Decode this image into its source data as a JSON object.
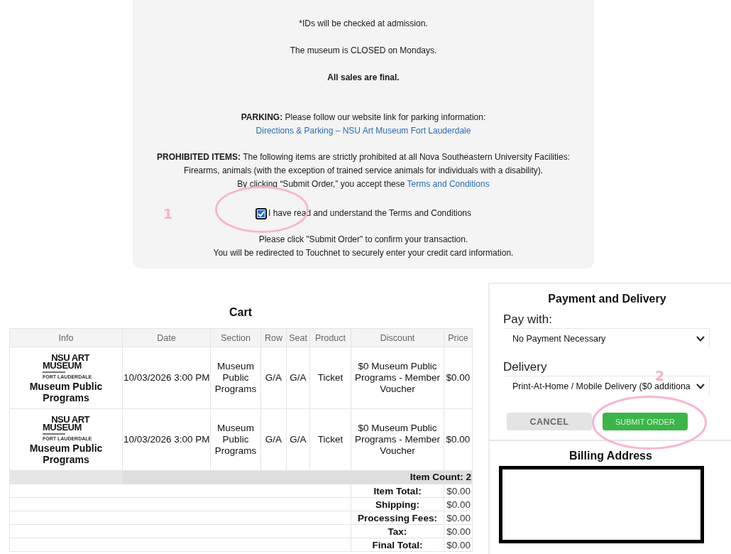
{
  "notice": {
    "id_note": "*IDs will be checked at admission.",
    "closed_note": "The museum is CLOSED on Mondays.",
    "final_note": "All sales are final.",
    "parking": {
      "text": "**PARKING:** Please follow our website link for parking information: ",
      "link": "Directions & Parking – NSU Art Museum Fort Lauderdale"
    },
    "prohibited": "**PROHIBITED ITEMS:** The following items are strictly prohibited at all Nova Southeastern University Facilities: Firearms, animals (with the exception of trained service animals for individuals with a disability).",
    "accept": {
      "text": "By clicking “Submit Order,” you accept these ",
      "link": "Terms and Conditions"
    },
    "agree": {
      "label": "I have read and understand the Terms and Conditions",
      "checked": true,
      "annotation": "1"
    },
    "instructions": [
      "Please click \"Submit Order\" to confirm your transaction.",
      "You will be redirected to Touchnet to securely enter your credit card information."
    ]
  },
  "cart": {
    "title": "Cart",
    "columns": [
      "Info",
      "Date",
      "Section",
      "Row",
      "Seat",
      "Product",
      "Discount",
      "Price"
    ],
    "rows": [
      {
        "logo": {
          "lines": [
            "NSU ART",
            "MUSEUM"
          ],
          "subtitle": "FORT LAUDERDALE"
        },
        "event": "Museum Public Programs",
        "date": "10/03/2026 3:00 PM",
        "section": "Museum Public Programs",
        "row": "G/A",
        "seat": "G/A",
        "product": "Ticket",
        "discount": "$0 Museum Public Programs - Member Voucher",
        "price": "$0.00"
      },
      {
        "logo": {
          "lines": [
            "NSU ART",
            "MUSEUM"
          ],
          "subtitle": "FORT LAUDERDALE"
        },
        "event": "Museum Public Programs",
        "date": "10/03/2026 3:00 PM",
        "section": "Museum Public Programs",
        "row": "G/A",
        "seat": "G/A",
        "product": "Ticket",
        "discount": "$0 Museum Public Programs - Member Voucher",
        "price": "$0.00"
      }
    ],
    "item_count": "Item Count: 2",
    "totals": [
      {
        "label": "Item Total:",
        "value": "$0.00"
      },
      {
        "label": "Shipping:",
        "value": "$0.00"
      },
      {
        "label": "Processing Fees:",
        "value": "$0.00"
      },
      {
        "label": "Tax:",
        "value": "$0.00"
      },
      {
        "label": "Final Total:",
        "value": "$0.00"
      }
    ]
  },
  "payment": {
    "title": "Payment and Delivery",
    "fields": [
      {
        "label": "Pay with:",
        "value": "No Payment Necessary"
      },
      {
        "label": "Delivery",
        "value": "Print-At-Home / Mobile Delivery ($0 additiona"
      }
    ],
    "buttons": [
      {
        "label": "CANCEL",
        "kind": "secondary"
      },
      {
        "label": "SUBMIT ORDER",
        "kind": "primary",
        "annotation": "2"
      }
    ]
  },
  "billing": {
    "title": "Billing Address"
  }
}
